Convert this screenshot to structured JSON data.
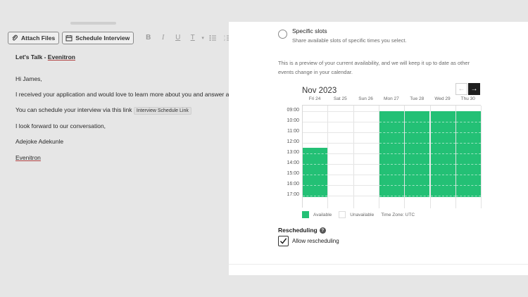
{
  "toolbar": {
    "attach_label": "Attach Files",
    "schedule_label": "Schedule Interview",
    "format_bold": "B",
    "format_italic": "I",
    "format_underline": "U",
    "format_text": "T"
  },
  "email": {
    "subject_prefix": "Let's Talk - ",
    "subject_company": "Evenitron",
    "greeting": "Hi James,",
    "line1": "I received your application and would love to learn more about you and answer any que",
    "line2_text": "You can schedule your interview via this link",
    "link_chip": "Interview Schedule Link",
    "line3": "I look forward to our conversation,",
    "signature_name": "Adejoke Adekunle",
    "signature_company": "Evenitron"
  },
  "panel": {
    "specific_title": "Specific slots",
    "specific_desc": "Share available slots of specific times you select.",
    "preview_text": "This is a preview of your current availability, and we will keep it up to date as other events change in your calendar.",
    "month": "Nov 2023",
    "prev_arrow": "←",
    "next_arrow": "→",
    "days": [
      "Fri 24",
      "Sat 25",
      "Sun 26",
      "Mon 27",
      "Tue 28",
      "Wed 29",
      "Thu 30"
    ],
    "times": [
      "09:00",
      "10:00",
      "11:00",
      "12:00",
      "13:00",
      "14:00",
      "15:00",
      "16:00",
      "17:00"
    ],
    "availability": [
      {
        "day": "Fri 24",
        "from": "12:30",
        "to": "18:00"
      },
      {
        "day": "Mon 27",
        "from": "09:00",
        "to": "18:00"
      },
      {
        "day": "Tue 28",
        "from": "09:00",
        "to": "18:00"
      },
      {
        "day": "Wed 29",
        "from": "09:00",
        "to": "18:00"
      },
      {
        "day": "Thu 30",
        "from": "09:00",
        "to": "18:00"
      }
    ],
    "legend_available": "Available",
    "legend_unavailable": "Unavailable",
    "timezone": "Time Zone: UTC",
    "rescheduling_title": "Rescheduling",
    "allow_rescheduling": "Allow rescheduling",
    "allow_rescheduling_checked": true,
    "colors": {
      "available": "#23c075",
      "next_button": "#1f1f1f"
    }
  }
}
